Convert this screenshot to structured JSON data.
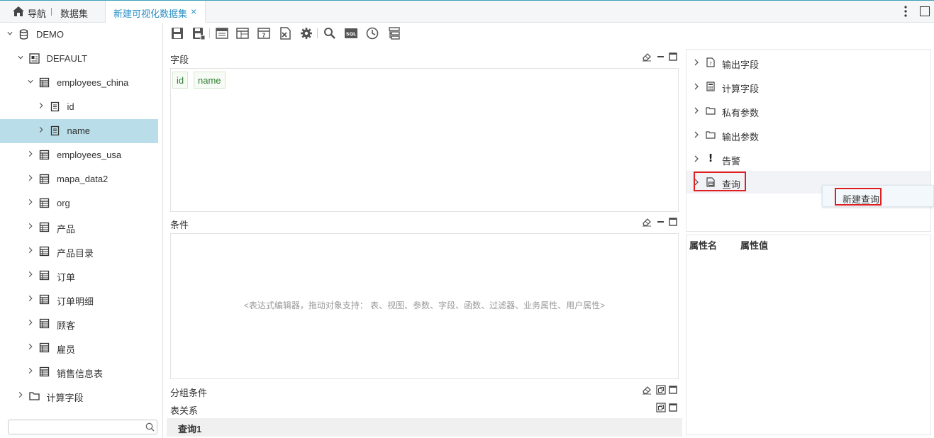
{
  "topbar": {
    "nav_label": "导航",
    "dataset_label": "数据集",
    "active_tab": "新建可视化数据集",
    "close_glyph": "×"
  },
  "tree": {
    "items": [
      {
        "label": "DEMO",
        "icon": "database-icon",
        "expanded": true
      },
      {
        "label": "DEFAULT",
        "icon": "schema-icon",
        "expanded": true
      },
      {
        "label": "employees_china",
        "icon": "table-icon",
        "expanded": true
      },
      {
        "label": "id",
        "icon": "column-icon",
        "expanded": false
      },
      {
        "label": "name",
        "icon": "column-icon",
        "expanded": false,
        "selected": true
      },
      {
        "label": "employees_usa",
        "icon": "table-icon",
        "expanded": false
      },
      {
        "label": "mapa_data2",
        "icon": "table-icon",
        "expanded": false
      },
      {
        "label": "org",
        "icon": "table-icon",
        "expanded": false
      },
      {
        "label": "产品",
        "icon": "table-icon",
        "expanded": false
      },
      {
        "label": "产品目录",
        "icon": "table-icon",
        "expanded": false
      },
      {
        "label": "订单",
        "icon": "table-icon",
        "expanded": false
      },
      {
        "label": "订单明细",
        "icon": "table-icon",
        "expanded": false
      },
      {
        "label": "顾客",
        "icon": "table-icon",
        "expanded": false
      },
      {
        "label": "雇员",
        "icon": "table-icon",
        "expanded": false
      },
      {
        "label": "销售信息表",
        "icon": "table-icon",
        "expanded": false
      },
      {
        "label": "计算字段",
        "icon": "folder-icon",
        "expanded": false
      }
    ],
    "search_value": ""
  },
  "toolbar": {
    "buttons": [
      "save-icon",
      "save-as-icon",
      "preview-icon",
      "layout-icon",
      "help-doc-icon",
      "export-icon",
      "settings-gear-icon",
      "search-icon",
      "sql-icon",
      "clock-icon",
      "filter-tree-icon"
    ],
    "sql_text": "SQL"
  },
  "fields_panel": {
    "title": "字段",
    "chips": [
      "id",
      "name"
    ]
  },
  "condition_panel": {
    "title": "条件",
    "hint": "<表达式编辑器，拖动对象支持： 表、视图、参数、字段、函数、过滤器、业务属性、用户属性>"
  },
  "group_panel": {
    "title": "分组条件"
  },
  "relation_panel": {
    "title": "表关系"
  },
  "query_tab": {
    "label": "查询1"
  },
  "right_tree": {
    "items": [
      {
        "label": "输出字段",
        "icon": "output-field-icon"
      },
      {
        "label": "计算字段",
        "icon": "calculator-icon"
      },
      {
        "label": "私有参数",
        "icon": "folder-icon"
      },
      {
        "label": "输出参数",
        "icon": "folder-icon"
      },
      {
        "label": "告警",
        "icon": "alert-icon"
      },
      {
        "label": "查询",
        "icon": "query-icon"
      }
    ],
    "alert_glyph": "!"
  },
  "context_menu": {
    "item": "新建查询"
  },
  "properties": {
    "col_name": "属性名",
    "col_value": "属性值"
  },
  "colors": {
    "accent": "#2a8fc4",
    "selected_row": "#b9dde9",
    "highlight_border": "#e02020",
    "field_chip_text": "#2e7d32"
  }
}
